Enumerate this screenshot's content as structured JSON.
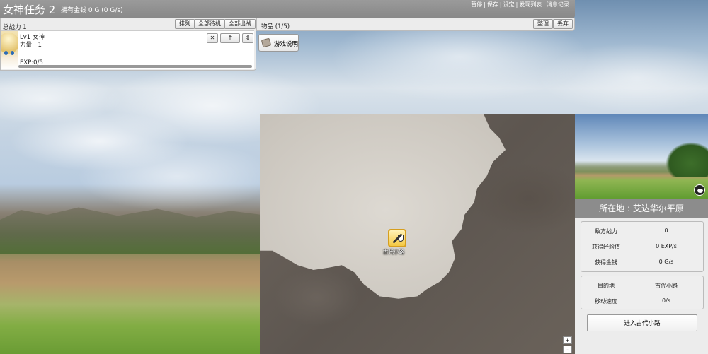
{
  "header": {
    "title": "女神任务 2",
    "money": "拥有金钱 0 G (0 G/s)",
    "links": [
      "暂停",
      "保存",
      "设定",
      "发现列表",
      "消息记录"
    ]
  },
  "party": {
    "total_power": "总战力 1",
    "buttons": {
      "sort": "排列",
      "all_standby": "全部待机",
      "all_deploy": "全部出战"
    },
    "unit": {
      "name": "Lv1 女神",
      "strength": "力量　1",
      "exp": "EXP:0/5",
      "exp_progress": 0,
      "controls": {
        "remove": "✕",
        "up": "↑",
        "swap": "⇕"
      }
    }
  },
  "items": {
    "header": "物品 (1/5)",
    "buttons": {
      "organize": "整理",
      "discard": "丢弃"
    },
    "help_button": "游戏说明",
    "help_icon": "scroll-icon"
  },
  "map": {
    "location_label": "古代小路",
    "location_icon": "sword-shield-icon",
    "zoom_in": "+",
    "zoom_out": "-"
  },
  "location_panel": {
    "title": "所在地 : 艾达华尔平原",
    "stats": [
      {
        "label": "敌方战力",
        "value": "0"
      },
      {
        "label": "获得经验值",
        "value": "0 EXP/s"
      },
      {
        "label": "获得金钱",
        "value": "0 G/s"
      }
    ],
    "travel": [
      {
        "label": "目的地",
        "value": "古代小路"
      },
      {
        "label": "移动速度",
        "value": "0/s"
      }
    ],
    "enter_button": "进入古代小路"
  },
  "colors": {
    "topbar": "#8f8f8f",
    "location_title_bg": "#8c8c8c",
    "node_gold": "#f4c843"
  }
}
